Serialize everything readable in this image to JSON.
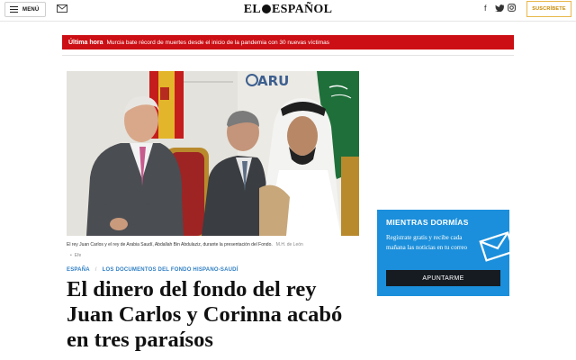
{
  "header": {
    "menu_label": "MENÚ",
    "logo_left": "EL",
    "logo_right": "ESPAÑOL",
    "subscribe_label": "SUSCRÍBETE"
  },
  "icons": [
    "hamburger-icon",
    "mail-icon",
    "facebook-icon",
    "twitter-icon",
    "instagram-icon",
    "envelope-icon"
  ],
  "social": {
    "facebook": "f",
    "twitter": "🐦",
    "instagram": "◎"
  },
  "breaking": {
    "label": "Última hora",
    "text": "Murcia bate récord de muertes desde el inicio de la pandemia con 30 nuevas víctimas"
  },
  "photo": {
    "backdrop_text": "ARU",
    "caption": "El rey Juan Carlos y el rey de Arabia Saudí, Abdallah Bin Abdulaziz, durante la presentación del Fondo.",
    "credit": "M.H. de León",
    "source": "Efe"
  },
  "article": {
    "section": "ESPAÑA",
    "separator": "/",
    "topic": "LOS DOCUMENTOS DEL FONDO HISPANO-SAUDÍ",
    "headline": "El dinero del fondo del rey Juan Carlos y Corinna acabó en tres paraísos"
  },
  "newsletter": {
    "title": "MIENTRAS DORMÍAS",
    "text": "Regístrate gratis y recibe cada mañana las noticias en tu correo",
    "button": "APUNTARME"
  },
  "colors": {
    "breaking_red": "#cc0f14",
    "section_blue": "#2f7fc5",
    "newsletter_blue": "#1b8fdb",
    "subscribe_gold": "#e8b84a"
  }
}
